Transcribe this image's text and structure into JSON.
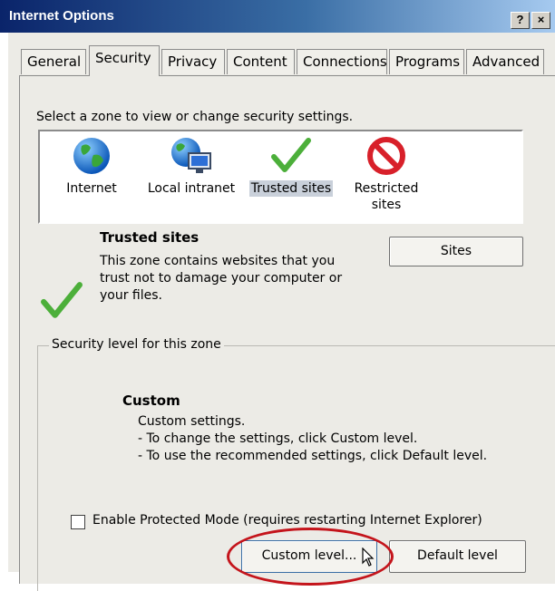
{
  "window": {
    "title": "Internet Options",
    "help_btn": "?",
    "close_btn": "×"
  },
  "tabs": [
    "General",
    "Security",
    "Privacy",
    "Content",
    "Connections",
    "Programs",
    "Advanced"
  ],
  "active_tab": "Security",
  "zones": {
    "prompt": "Select a zone to view or change security settings.",
    "items": [
      {
        "label": "Internet",
        "icon": "globe-icon"
      },
      {
        "label": "Local intranet",
        "icon": "intranet-icon"
      },
      {
        "label": "Trusted sites",
        "icon": "checkmark-icon",
        "selected": true
      },
      {
        "label": "Restricted sites",
        "icon": "restricted-icon"
      }
    ]
  },
  "zone_detail": {
    "title": "Trusted sites",
    "description": "This zone contains websites that you trust not to damage your computer or your files.",
    "sites_btn": "Sites"
  },
  "security_level": {
    "legend": "Security level for this zone",
    "name": "Custom",
    "lines": [
      "Custom settings.",
      "- To change the settings, click Custom level.",
      "- To use the recommended settings, click Default level."
    ],
    "protected_mode_label": "Enable Protected Mode (requires restarting Internet Explorer)",
    "protected_mode_checked": false,
    "custom_level_btn": "Custom level...",
    "default_level_btn": "Default level"
  },
  "colors": {
    "annotation_circle": "#c4141b",
    "title_bar": "#0a246a",
    "check_green": "#4caf3a"
  }
}
